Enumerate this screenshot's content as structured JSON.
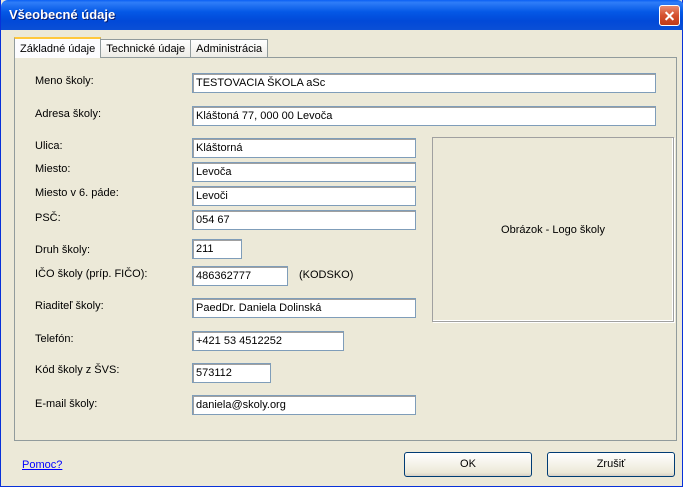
{
  "window": {
    "title": "Všeobecné údaje"
  },
  "tabs": [
    {
      "label": "Základné údaje",
      "active": true
    },
    {
      "label": "Technické údaje",
      "active": false
    },
    {
      "label": "Administrácia",
      "active": false
    }
  ],
  "form": {
    "meno_skoly": {
      "label": "Meno školy:",
      "value": "TESTOVACIA ŠKOLA aSc"
    },
    "adresa_skoly": {
      "label": "Adresa školy:",
      "value": "Kláštoná 77, 000 00 Levoča"
    },
    "ulica": {
      "label": "Ulica:",
      "value": "Kláštorná"
    },
    "miesto": {
      "label": "Miesto:",
      "value": "Levoča"
    },
    "miesto_6": {
      "label": "Miesto v 6. páde:",
      "value": "Levoči"
    },
    "psc": {
      "label": "PSČ:",
      "value": "054 67"
    },
    "druh_skoly": {
      "label": "Druh školy:",
      "value": "211"
    },
    "ico": {
      "label": "IČO školy (príp. FIČO):",
      "value": "486362777",
      "suffix": "(KODSKO)"
    },
    "riaditel": {
      "label": "Riaditeľ školy:",
      "value": "PaedDr. Daniela Dolinská"
    },
    "telefon": {
      "label": "Telefón:",
      "value": "+421 53 4512252"
    },
    "kod_svs": {
      "label": "Kód školy z ŠVS:",
      "value": "573112"
    },
    "email": {
      "label": "E-mail školy:",
      "value": "daniela@skoly.org"
    }
  },
  "logo": {
    "label": "Obrázok - Logo školy"
  },
  "footer": {
    "help": "Pomoc?",
    "ok": "OK",
    "cancel": "Zrušiť"
  }
}
